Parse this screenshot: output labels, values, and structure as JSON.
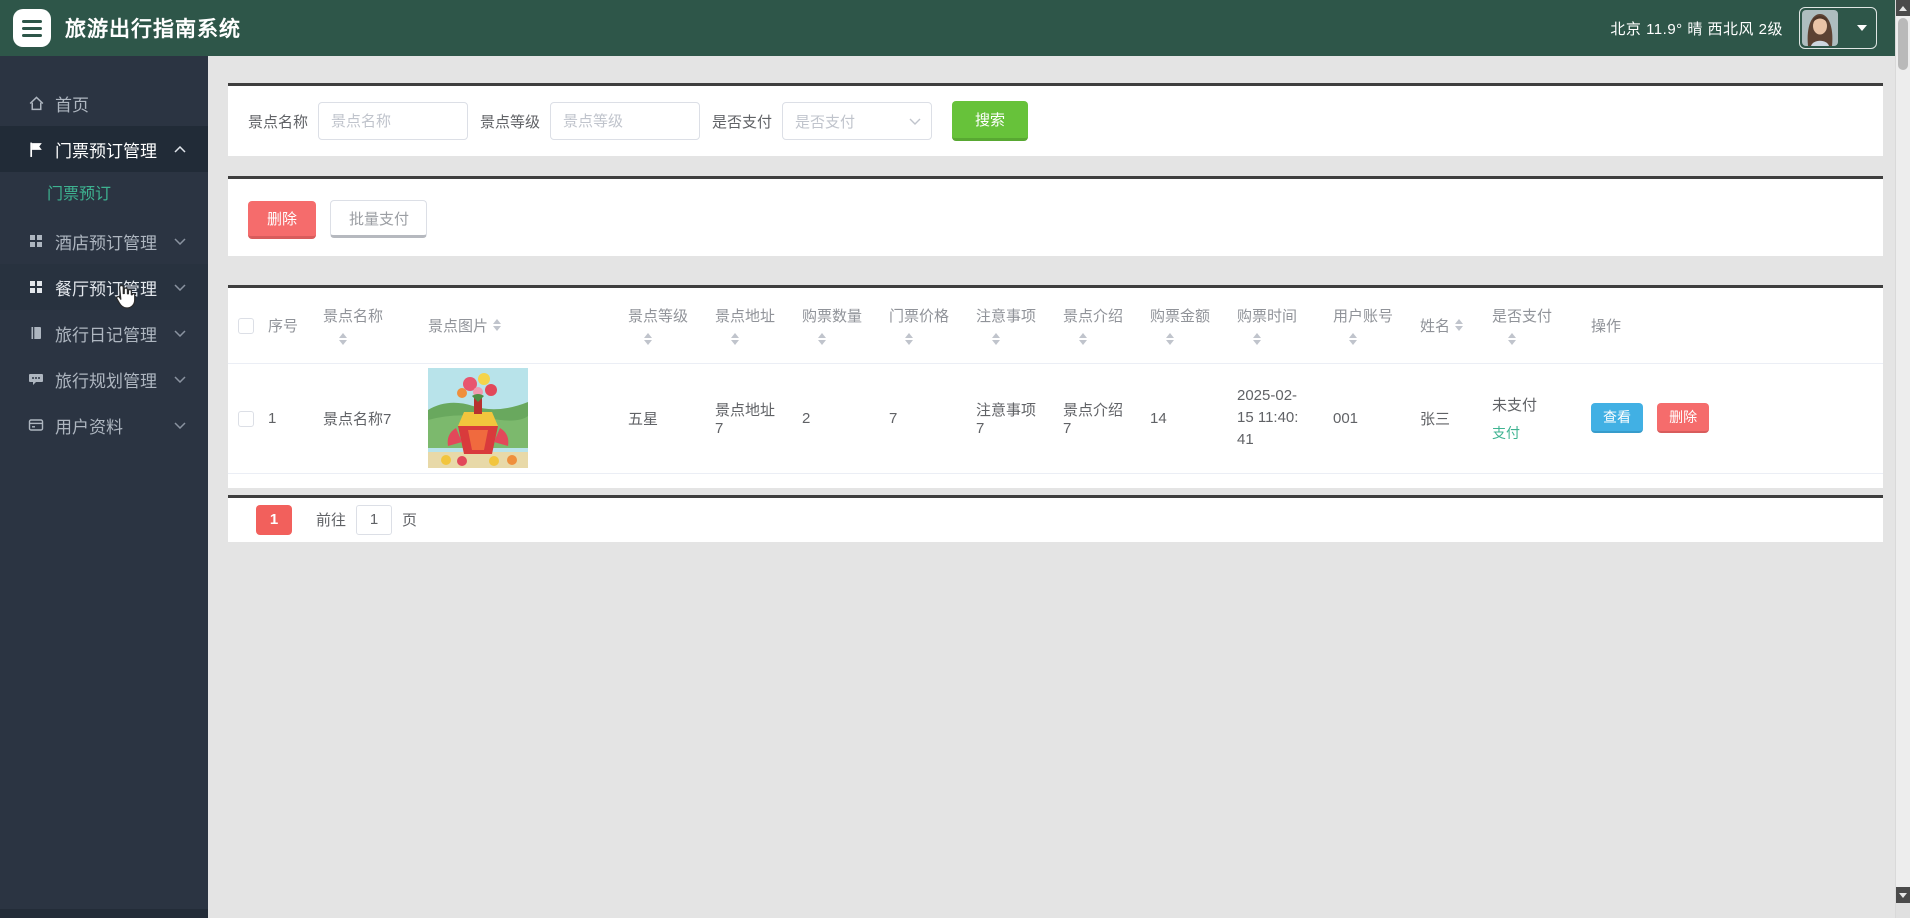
{
  "app": {
    "title": "旅游出行指南系统"
  },
  "header": {
    "weather": "北京  11.9°  晴  西北风  2级",
    "icons": [
      "hamburger-menu-icon",
      "avatar",
      "chevron-down-icon"
    ]
  },
  "sidebar": {
    "items": [
      {
        "label": "首页",
        "icon": "home-icon",
        "expandable": false
      },
      {
        "label": "门票预订管理",
        "icon": "flag-icon",
        "expandable": true,
        "state": "expanded",
        "active": true
      },
      {
        "label": "酒店预订管理",
        "icon": "grid-icon",
        "expandable": true,
        "state": "collapsed"
      },
      {
        "label": "餐厅预订管理",
        "icon": "grid-icon",
        "expandable": true,
        "state": "collapsed",
        "hovered": true
      },
      {
        "label": "旅行日记管理",
        "icon": "book-icon",
        "expandable": true,
        "state": "collapsed"
      },
      {
        "label": "旅行规划管理",
        "icon": "chat-icon",
        "expandable": true,
        "state": "collapsed"
      },
      {
        "label": "用户资料",
        "icon": "profile-card-icon",
        "expandable": true,
        "state": "collapsed"
      }
    ],
    "submenu": {
      "label": "门票预订",
      "active": true
    }
  },
  "filters": {
    "name_label": "景点名称",
    "name_placeholder": "景点名称",
    "grade_label": "景点等级",
    "grade_placeholder": "景点等级",
    "paid_label": "是否支付",
    "paid_placeholder": "是否支付",
    "search_label": "搜索"
  },
  "toolbar": {
    "delete_label": "删除",
    "batch_pay_label": "批量支付"
  },
  "table": {
    "columns": [
      "序号",
      "景点名称",
      "景点图片",
      "景点等级",
      "景点地址",
      "购票数量",
      "门票价格",
      "注意事项",
      "景点介绍",
      "购票金额",
      "购票时间",
      "用户账号",
      "姓名",
      "是否支付",
      "操作"
    ],
    "rows": [
      {
        "index": "1",
        "name": "景点名称7",
        "image": "festival-float-photo",
        "grade": "五星",
        "address": "景点地址7",
        "quantity": "2",
        "price": "7",
        "notes": "注意事项7",
        "intro": "景点介绍7",
        "amount": "14",
        "time": "2025-02-15 11:40:41",
        "account": "001",
        "username": "张三",
        "paid_status": "未支付",
        "pay_action": "支付",
        "actions": {
          "view": "查看",
          "delete": "删除"
        }
      }
    ]
  },
  "pagination": {
    "current": "1",
    "goto_label": "前往",
    "goto_value": "1",
    "unit_label": "页"
  },
  "colors": {
    "header_bg": "#2e5649",
    "sidebar_bg": "#2b3442",
    "accent_red": "#f56c6c",
    "accent_green": "#67c23a",
    "accent_blue": "#41b0e4",
    "link_green": "#3eb391",
    "pagination_active": "#f2605c"
  }
}
